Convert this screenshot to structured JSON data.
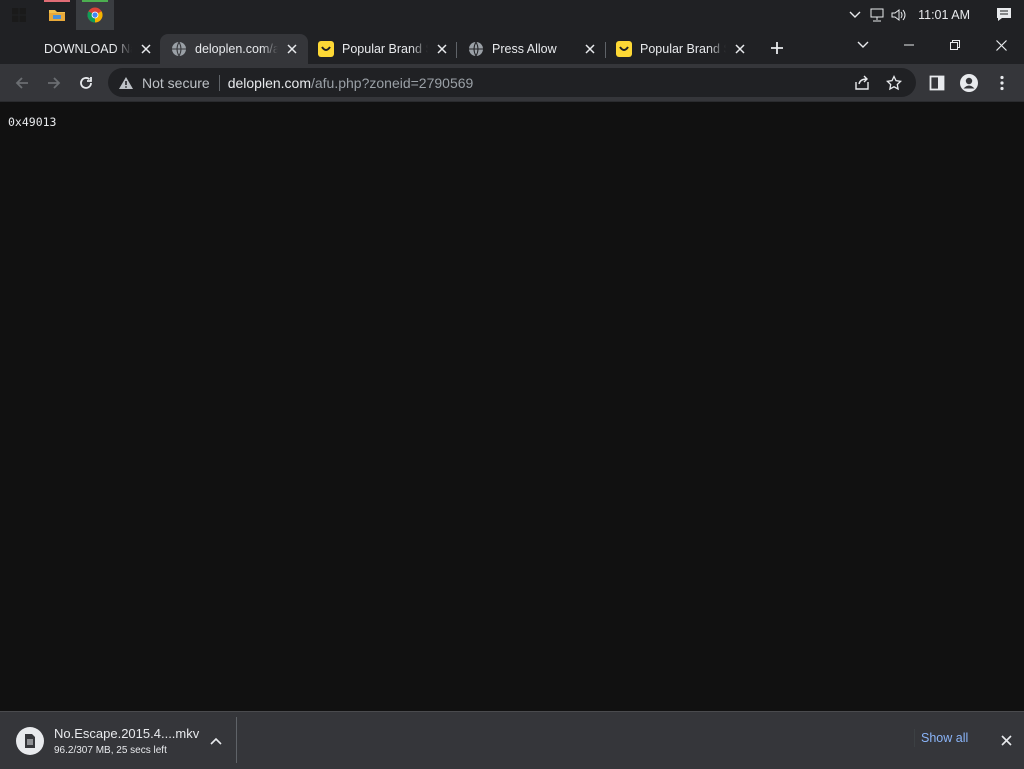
{
  "taskbar": {
    "clock": "11:01 AM",
    "marker_colors": {
      "explorer": "#e06c75",
      "chrome": "#4caf50"
    }
  },
  "tabs": [
    {
      "title": "DOWNLOAD Na",
      "favicon": "none"
    },
    {
      "title": "deloplen.com/a",
      "favicon": "globe-icon"
    },
    {
      "title": "Popular Brand S",
      "favicon": "smile-icon"
    },
    {
      "title": "Press Allow",
      "favicon": "globe-icon"
    },
    {
      "title": "Popular Brand S",
      "favicon": "smile-icon"
    }
  ],
  "omnibox": {
    "security_label": "Not secure",
    "url_host": "deloplen.com",
    "url_path": "/afu.php?zoneid=2790569"
  },
  "page": {
    "body_text": "0x49013"
  },
  "download": {
    "filename": "No.Escape.2015.4....mkv",
    "status": "96.2/307 MB, 25 secs left",
    "show_all_label": "Show all"
  },
  "colors": {
    "background": "#111111",
    "tab_active": "#35363a",
    "link": "#8ab4f8",
    "smile_favicon": "#fdd835"
  }
}
